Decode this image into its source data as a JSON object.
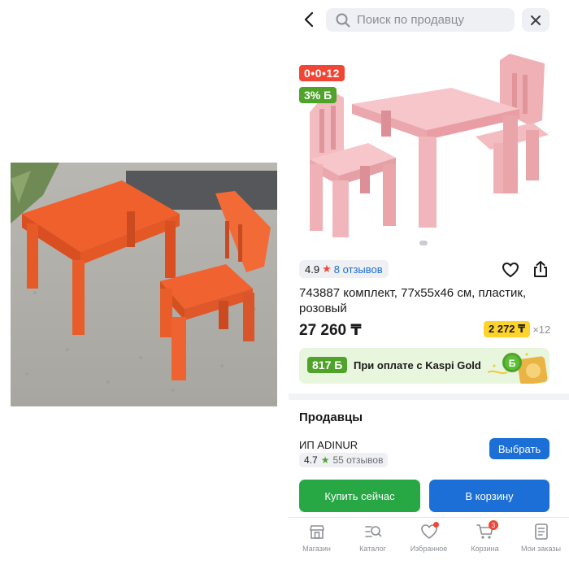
{
  "search": {
    "placeholder": "Поиск по продавцу"
  },
  "product": {
    "timer_badge": "0•0•12",
    "bonus_badge": "3% Б",
    "rating": "4.9",
    "reviews_link": "8 отзывов",
    "title": "743887 комплект, 77x55x46 см, пластик, розовый",
    "price": "27 260 ₸",
    "installment_amount": "2 272 ₸",
    "installment_count": "×12"
  },
  "kaspi_banner": {
    "bonus": "817 Б",
    "text": "При оплате с Kaspi Gold"
  },
  "sellers": {
    "title": "Продавцы",
    "name": "ИП ADINUR",
    "rating": "4.7",
    "reviews": "55 отзывов",
    "choose_label": "Выбрать"
  },
  "actions": {
    "buy_now": "Купить сейчас",
    "to_cart": "В корзину"
  },
  "tabbar": {
    "items": [
      {
        "label": "Магазин",
        "icon": "shop-icon"
      },
      {
        "label": "Каталог",
        "icon": "catalog-search-icon"
      },
      {
        "label": "Избранное",
        "icon": "heart-icon"
      },
      {
        "label": "Корзина",
        "icon": "cart-icon"
      },
      {
        "label": "Мои заказы",
        "icon": "orders-icon"
      }
    ],
    "cart_count": "3"
  },
  "colors": {
    "accent_blue": "#1b6fd6",
    "buy_green": "#28a745",
    "timer_red": "#f14635",
    "bonus_green": "#4fa32b",
    "installment_yellow": "#ffd42a"
  }
}
